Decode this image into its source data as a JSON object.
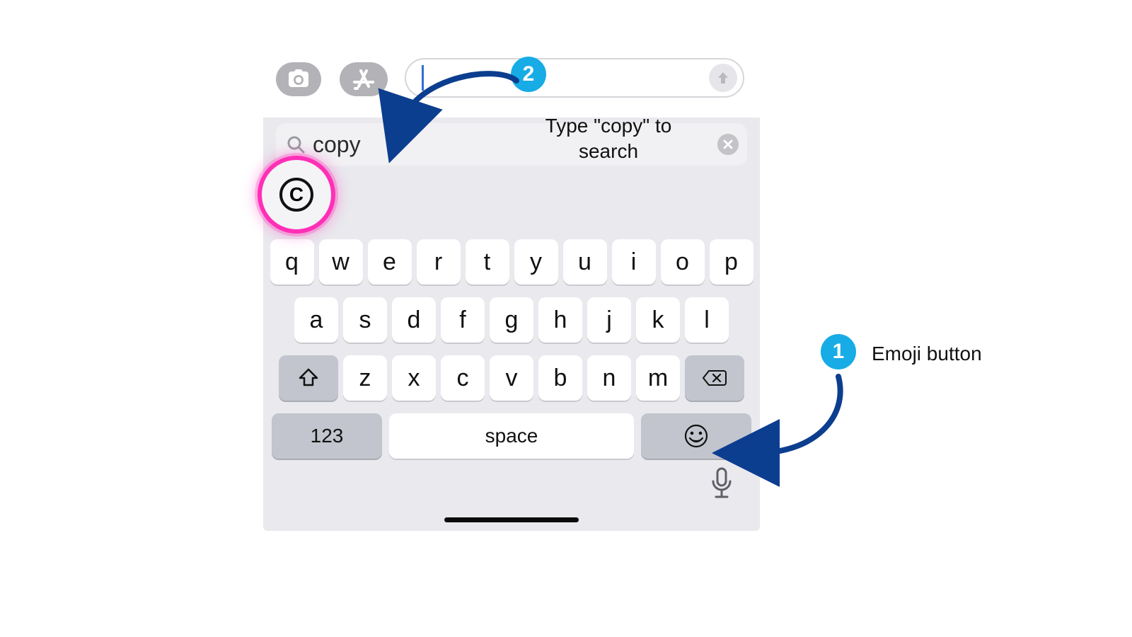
{
  "compose": {
    "value": ""
  },
  "search": {
    "value": "copy"
  },
  "result": {
    "emoji_name": "copyright",
    "glyph_inner": "C"
  },
  "keyboard": {
    "row1": [
      "q",
      "w",
      "e",
      "r",
      "t",
      "y",
      "u",
      "i",
      "o",
      "p"
    ],
    "row2": [
      "a",
      "s",
      "d",
      "f",
      "g",
      "h",
      "j",
      "k",
      "l"
    ],
    "row3": [
      "z",
      "x",
      "c",
      "v",
      "b",
      "n",
      "m"
    ],
    "numeric_label": "123",
    "space_label": "space"
  },
  "annotations": {
    "step1": {
      "num": "1",
      "label": "Emoji button"
    },
    "step2": {
      "num": "2",
      "label": "Type \"copy\" to search"
    }
  }
}
